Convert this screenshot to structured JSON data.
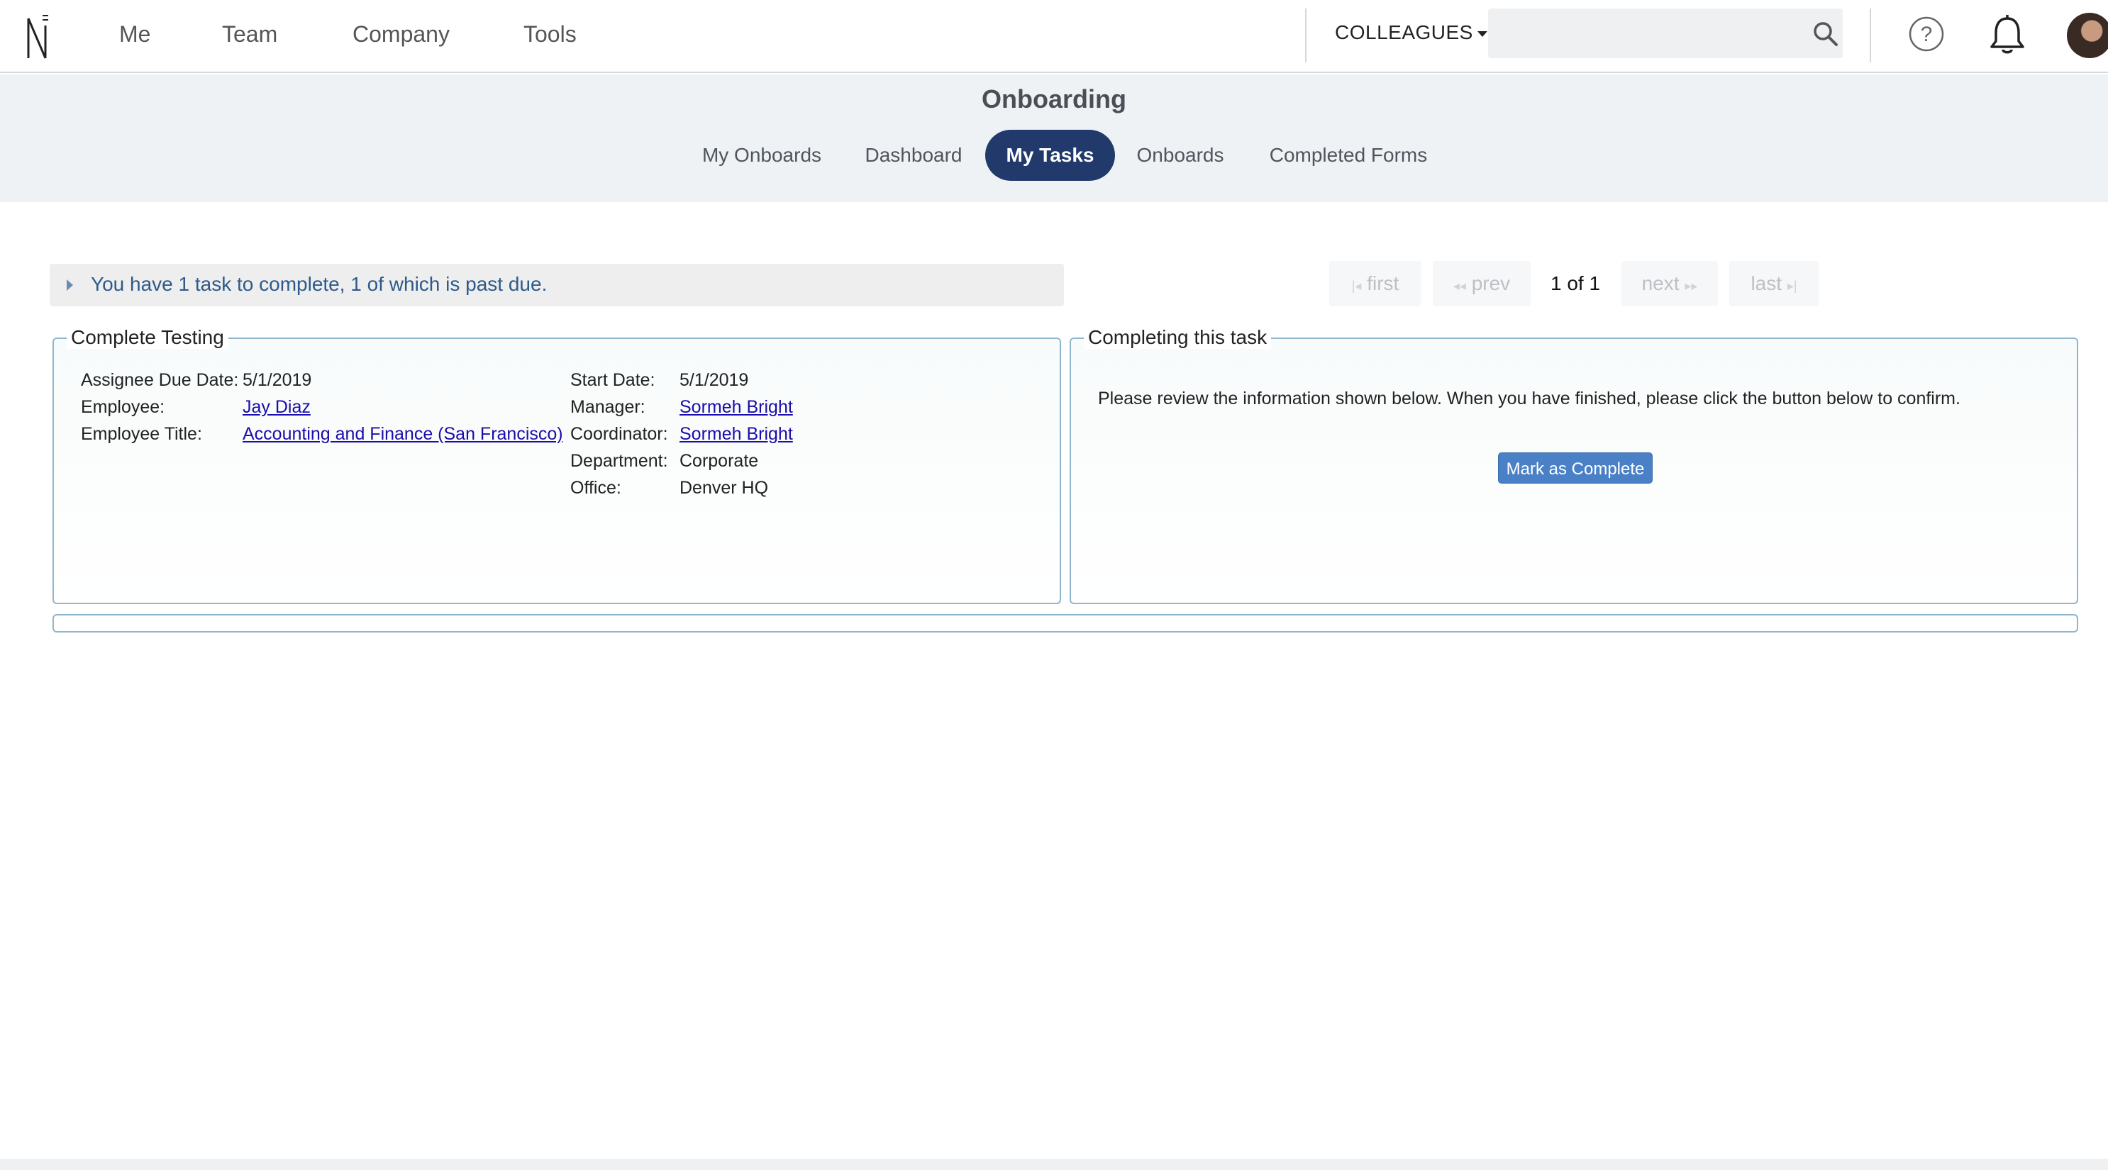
{
  "nav": {
    "items": [
      {
        "label": "Me"
      },
      {
        "label": "Team"
      },
      {
        "label": "Company"
      },
      {
        "label": "Tools"
      }
    ],
    "colleagues_label": "COLLEAGUES",
    "search": {
      "placeholder": "",
      "value": ""
    },
    "icons": [
      "logo",
      "search-icon",
      "help-icon",
      "bell-icon",
      "avatar"
    ]
  },
  "subheader": {
    "title": "Onboarding",
    "tabs": [
      {
        "label": "My Onboards",
        "active": false
      },
      {
        "label": "Dashboard",
        "active": false
      },
      {
        "label": "My Tasks",
        "active": true
      },
      {
        "label": "Onboards",
        "active": false
      },
      {
        "label": "Completed Forms",
        "active": false
      }
    ]
  },
  "notice": {
    "text": "You have 1 task to complete, 1 of which is past due."
  },
  "pager": {
    "first": "first",
    "prev": "prev",
    "status": "1 of 1",
    "next": "next",
    "last": "last"
  },
  "task": {
    "title": "Complete Testing",
    "left_fields": [
      {
        "label": "Assignee Due Date:",
        "value": "5/1/2019",
        "link": false
      },
      {
        "label": "Employee:",
        "value": "Jay Diaz",
        "link": true
      },
      {
        "label": "Employee Title:",
        "value": "Accounting and Finance (San Francisco)",
        "link": true
      }
    ],
    "right_fields": [
      {
        "label": "Start Date:",
        "value": "5/1/2019",
        "link": false
      },
      {
        "label": "Manager:",
        "value": "Sormeh Bright",
        "link": true
      },
      {
        "label": "Coordinator:",
        "value": "Sormeh Bright",
        "link": true
      },
      {
        "label": "Department:",
        "value": "Corporate",
        "link": false
      },
      {
        "label": "Office:",
        "value": "Denver HQ",
        "link": false
      }
    ]
  },
  "completion": {
    "title": "Completing this task",
    "instructions": "Please review the information shown below. When you have finished, please click the button below to confirm.",
    "button_label": "Mark as Complete"
  },
  "colors": {
    "active_tab": "#213a6b",
    "button": "#4a80c6",
    "panel_border": "#8fb6cc",
    "link": "#1a0dab",
    "notice_text": "#2d5a8a"
  }
}
